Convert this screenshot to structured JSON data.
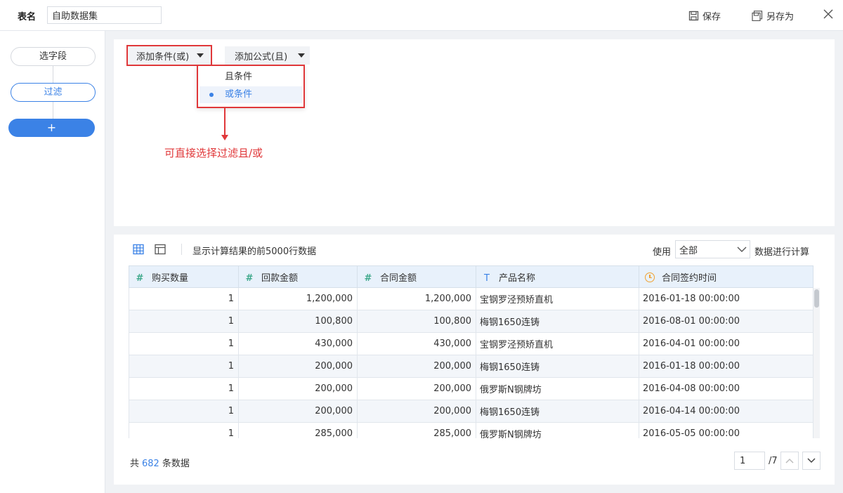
{
  "header": {
    "table_label": "表名",
    "table_name": "自助数据集",
    "save_label": "保存",
    "save_as_label": "另存为"
  },
  "sidebar": {
    "steps": [
      {
        "label": "选字段"
      },
      {
        "label": "过滤"
      }
    ],
    "add_label": "+"
  },
  "filter": {
    "add_condition_label": "添加条件(或)",
    "add_formula_label": "添加公式(且)",
    "dropdown_options": [
      "且条件",
      "或条件"
    ],
    "selected_option": "或条件",
    "annotation": "可直接选择过滤且/或"
  },
  "preview": {
    "info_text": "显示计算结果的前5000行数据",
    "use_label": "使用",
    "use_value": "全部",
    "use_suffix": "数据进行计算",
    "columns": [
      {
        "label": "购买数量",
        "type": "number"
      },
      {
        "label": "回款金额",
        "type": "number"
      },
      {
        "label": "合同金额",
        "type": "number"
      },
      {
        "label": "产品名称",
        "type": "text"
      },
      {
        "label": "合同签约时间",
        "type": "time"
      }
    ],
    "rows": [
      [
        "1",
        "1,200,000",
        "1,200,000",
        "宝钢罗泾预矫直机",
        "2016-01-18 00:00:00"
      ],
      [
        "1",
        "100,800",
        "100,800",
        "梅钢1650连铸",
        "2016-08-01 00:00:00"
      ],
      [
        "1",
        "430,000",
        "430,000",
        "宝钢罗泾预矫直机",
        "2016-04-01 00:00:00"
      ],
      [
        "1",
        "200,000",
        "200,000",
        "梅钢1650连铸",
        "2016-01-18 00:00:00"
      ],
      [
        "1",
        "200,000",
        "200,000",
        "俄罗斯N钢牌坊",
        "2016-04-08 00:00:00"
      ],
      [
        "1",
        "200,000",
        "200,000",
        "梅钢1650连铸",
        "2016-04-14 00:00:00"
      ],
      [
        "1",
        "285,000",
        "285,000",
        "俄罗斯N钢牌坊",
        "2016-05-05 00:00:00"
      ]
    ]
  },
  "footer": {
    "total_prefix": "共",
    "total_count": "682",
    "total_suffix": "条数据",
    "page_current": "1",
    "page_total": "/7"
  },
  "colors": {
    "accent": "#3b82e6",
    "annotation": "#e0383a",
    "header_bg": "#e8f1fb",
    "number_icon": "#3fa98c",
    "time_icon": "#f0a030"
  }
}
